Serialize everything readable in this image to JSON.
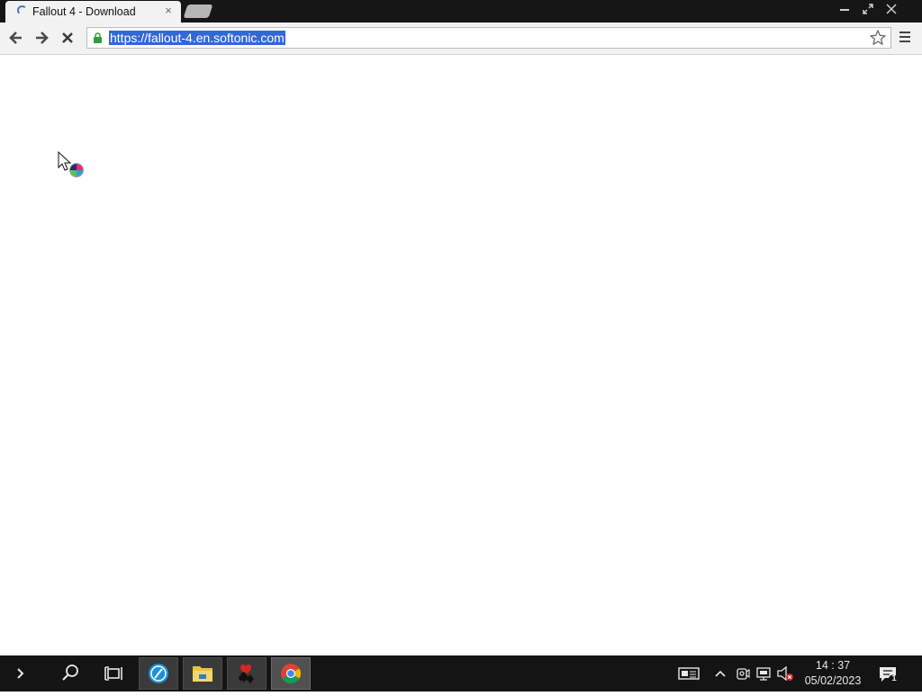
{
  "browser": {
    "tab": {
      "title": "Fallout 4 - Download",
      "close_glyph": "×",
      "loading": true
    },
    "window_controls": {
      "minimize": "–",
      "maximize": "⤡",
      "close": "✕"
    },
    "toolbar": {
      "back_icon": "arrow-left-icon",
      "forward_icon": "arrow-right-icon",
      "stop_icon": "stop-x-icon",
      "url": "https://fallout-4.en.softonic.com",
      "url_selected": true,
      "secure_icon": "lock-icon",
      "bookmark_icon": "star-icon",
      "menu_icon": "hamburger-menu-icon"
    }
  },
  "page": {
    "state": "blank-loading"
  },
  "cursor": {
    "type": "arrow-busy-icon"
  },
  "taskbar": {
    "start_icon": "chevron-right-icon",
    "search_icon": "search-icon",
    "task_view_icon": "task-view-icon",
    "apps": [
      {
        "name": "browser-blue-app",
        "active": false
      },
      {
        "name": "file-explorer-app",
        "active": false
      },
      {
        "name": "solitaire-app",
        "active": false
      },
      {
        "name": "chrome-app",
        "active": true
      }
    ],
    "tray": {
      "icons": [
        "news-icon",
        "chevron-up-icon",
        "webcam-icon",
        "network-icon",
        "volume-muted-icon"
      ],
      "time": "14 : 37",
      "date": "05/02/2023",
      "notification_count": "1"
    }
  },
  "colors": {
    "selection": "#3268d6",
    "titlebar": "#161616",
    "taskbar": "#141414",
    "lock": "#2e9d3a"
  }
}
